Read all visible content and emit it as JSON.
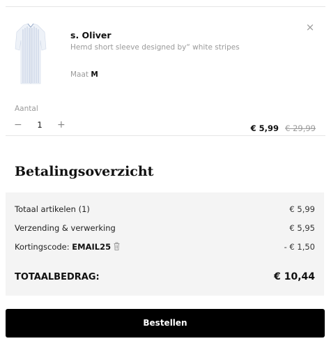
{
  "cart_item": {
    "brand": "s. Oliver",
    "product_name": "Hemd short sleeve designed by“ white stripes",
    "size_label": "Maat",
    "size_value": "M",
    "close_icon": "×",
    "quantity_label": "Aantal",
    "quantity_minus": "−",
    "quantity_value": "1",
    "quantity_plus": "+",
    "price_current": "€ 5,99",
    "price_original": "€ 29,99"
  },
  "summary": {
    "title": "Betalingsoverzicht",
    "rows": [
      {
        "label": "Totaal artikelen (1)",
        "value": "€ 5,99"
      },
      {
        "label": "Verzending & verwerking",
        "value": "€ 5,95"
      }
    ],
    "discount": {
      "label": "Kortingscode: ",
      "code": "EMAIL25",
      "value": "- € 1,50",
      "icon": "trash-icon"
    },
    "total_label": "TOTAALBEDRAG:",
    "total_value": "€ 10,44"
  },
  "order_button": "Bestellen",
  "colors": {
    "button_bg": "#000000",
    "summary_bg": "#f4f4f4",
    "muted_text": "#9a9a9a"
  }
}
